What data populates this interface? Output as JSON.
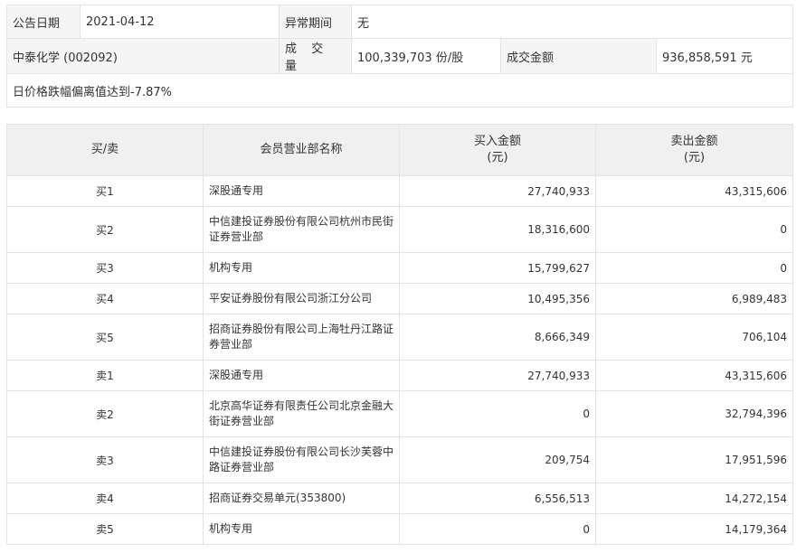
{
  "info": {
    "announce_date_label": "公告日期",
    "announce_date": "2021-04-12",
    "anomaly_period_label": "异常期间",
    "anomaly_period": "无",
    "stock": "中泰化学 (002092)",
    "volume_label": "成 交 量",
    "volume": "100,339,703 份/股",
    "amount_label": "成交金额",
    "amount": "936,858,591 元",
    "reason": "日价格跌幅偏离值达到-7.87%"
  },
  "deals": {
    "headers": {
      "side": "买/卖",
      "dept": "会员营业部名称",
      "buy_line1": "买入金额",
      "buy_line2": "(元)",
      "sell_line1": "卖出金额",
      "sell_line2": "(元)"
    },
    "rows": [
      {
        "side": "买1",
        "dept_line1": "深股通专用",
        "dept_line2": "",
        "buy": "27,740,933",
        "sell": "43,315,606"
      },
      {
        "side": "买2",
        "dept_line1": "中信建投证券股份有限公司杭州市民街",
        "dept_line2": "证券营业部",
        "buy": "18,316,600",
        "sell": "0"
      },
      {
        "side": "买3",
        "dept_line1": "机构专用",
        "dept_line2": "",
        "buy": "15,799,627",
        "sell": "0"
      },
      {
        "side": "买4",
        "dept_line1": "平安证券股份有限公司浙江分公司",
        "dept_line2": "",
        "buy": "10,495,356",
        "sell": "6,989,483"
      },
      {
        "side": "买5",
        "dept_line1": "招商证券股份有限公司上海牡丹江路证",
        "dept_line2": "券营业部",
        "buy": "8,666,349",
        "sell": "706,104"
      },
      {
        "side": "卖1",
        "dept_line1": "深股通专用",
        "dept_line2": "",
        "buy": "27,740,933",
        "sell": "43,315,606"
      },
      {
        "side": "卖2",
        "dept_line1": "北京高华证券有限责任公司北京金融大",
        "dept_line2": "街证券营业部",
        "buy": "0",
        "sell": "32,794,396"
      },
      {
        "side": "卖3",
        "dept_line1": "中信建投证券股份有限公司长沙芙蓉中",
        "dept_line2": "路证券营业部",
        "buy": "209,754",
        "sell": "17,951,596"
      },
      {
        "side": "卖4",
        "dept_line1": "招商证券交易单元(353800)",
        "dept_line2": "",
        "buy": "6,556,513",
        "sell": "14,272,154"
      },
      {
        "side": "卖5",
        "dept_line1": "机构专用",
        "dept_line2": "",
        "buy": "0",
        "sell": "14,179,364"
      }
    ]
  }
}
